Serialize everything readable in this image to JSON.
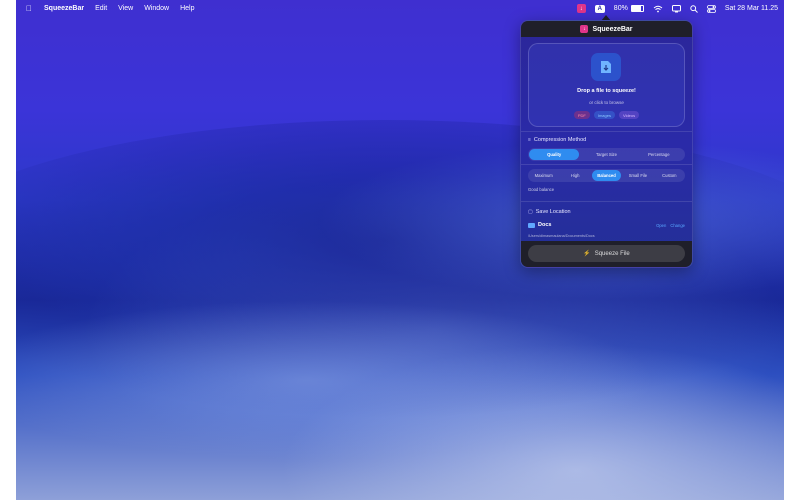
{
  "menubar": {
    "app_name": "SqueezeBar",
    "items": [
      "Edit",
      "View",
      "Window",
      "Help"
    ],
    "battery_percent": "80%",
    "battery_level": 0.8,
    "keyboard_indicator": "A",
    "clock": "Sat 28 Mar  11.25"
  },
  "popover": {
    "title": "SqueezeBar",
    "drop": {
      "title": "Drop a file to squeeze!",
      "subtitle": "or click to browse",
      "chips": [
        "PDF",
        "Images",
        "Videos"
      ]
    },
    "compression": {
      "title": "Compression Method",
      "modes": [
        "Quality",
        "Target Size",
        "Percentage"
      ],
      "active_mode": "Quality",
      "levels": [
        "Maximum",
        "High",
        "Balanced",
        "Small File",
        "Custom"
      ],
      "active_level": "Balanced",
      "description": "Good balance"
    },
    "save_location": {
      "title": "Save Location",
      "folder": "Docs",
      "open_label": "Open",
      "change_label": "Change",
      "path": "/Users/dimasmaulana/Documents/Docs"
    },
    "action": {
      "label": "Squeeze File"
    }
  },
  "colors": {
    "accent": "#2f8cf0",
    "brand": "#e0358a",
    "link": "#58a6ff"
  }
}
